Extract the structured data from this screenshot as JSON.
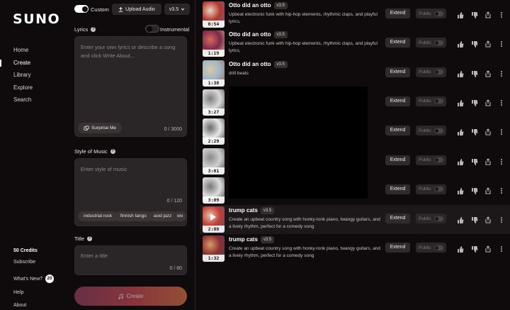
{
  "sidebar": {
    "logo": "SUNO",
    "nav": [
      "Home",
      "Create",
      "Library",
      "Explore",
      "Search"
    ],
    "active_nav": "Create",
    "credits": "50 Credits",
    "subscribe": "Subscribe",
    "whats_new": "What's New?",
    "whats_new_count": "20",
    "help": "Help",
    "about": "About"
  },
  "create_panel": {
    "custom_toggle_on": true,
    "custom_label": "Custom",
    "upload_audio": "Upload Audio",
    "version": "v3.5",
    "lyrics_label": "Lyrics",
    "instrumental_label": "Instrumental",
    "instrumental_on": false,
    "lyrics_placeholder": "Enter your own lyrics or describe a song and click Write About...",
    "lyrics_counter": "0 / 3000",
    "surprise_me": "Surprise Me",
    "style_label": "Style of Music",
    "style_placeholder": "Enter style of music",
    "style_counter": "0 / 120",
    "style_chips": [
      "industrial rock",
      "finnish tango",
      "acid jazz",
      "wo"
    ],
    "title_label": "Title",
    "title_placeholder": "Enter a title",
    "title_counter": "0 / 80",
    "create_button": "Create"
  },
  "songs": [
    {
      "title": "Otto did an otto",
      "version": "v3.5",
      "description": "Upbeat electronic funk with hip-hop elements, rhythmic claps, and playful lyrics,",
      "duration": "0:54",
      "extend": "Extend",
      "public": "Public",
      "thumb_colors": [
        "#b2352b",
        "#e8d6c2",
        "#5f6fa8"
      ]
    },
    {
      "title": "Otto did an otto",
      "version": "v3.5",
      "description": "Upbeat electronic funk with hip-hop elements, rhythmic claps, and playful lyrics,",
      "duration": "1:19",
      "extend": "Extend",
      "public": "Public",
      "thumb_colors": [
        "#7b2a4a",
        "#d6695c",
        "#e7c69a"
      ]
    },
    {
      "title": "Otto did an otto",
      "version": "v3.5",
      "description": "drill beats",
      "duration": "1:38",
      "extend": "Extend",
      "public": "Public",
      "thumb_colors": [
        "#9fb6c4",
        "#d8c9a8",
        "#a0593c"
      ]
    },
    {
      "title": "",
      "version": "",
      "description": "",
      "duration": "3:27",
      "extend": "Extend",
      "public": "Public",
      "thumb_colors": [
        "#d9d9d9",
        "#7e7e7e",
        "#2e2e2e"
      ]
    },
    {
      "title": "",
      "version": "",
      "description": "",
      "duration": "2:29",
      "extend": "Extend",
      "public": "Public",
      "thumb_colors": [
        "#e8e8e8",
        "#6a6a6a",
        "#1f1f1f"
      ]
    },
    {
      "title": "",
      "version": "",
      "description": "",
      "duration": "3:01",
      "extend": "Extend",
      "public": "Public",
      "thumb_colors": [
        "#cfcfcf",
        "#8a8a8a",
        "#3a3a3a"
      ]
    },
    {
      "title": "",
      "version": "",
      "description": "",
      "duration": "3:09",
      "extend": "Extend",
      "public": "Public",
      "thumb_colors": [
        "#dedede",
        "#777777",
        "#2a2a2a"
      ]
    },
    {
      "title": "trump cats",
      "version": "v3.5",
      "description": "Create an upbeat country song with honky-tonk piano, twangy guitars, and a lively rhythm, perfect for a comedy song",
      "duration": "2:08",
      "extend": "Extend",
      "public": "Public",
      "thumb_colors": [
        "#c23b35",
        "#e3c3a6",
        "#3d5e8a"
      ],
      "highlight": true
    },
    {
      "title": "trump cats",
      "version": "v3.5",
      "description": "Create an upbeat country song with honky-tonk piano, twangy guitars, and a lively rhythm, perfect for a comedy song",
      "duration": "1:32",
      "extend": "Extend",
      "public": "Public",
      "thumb_colors": [
        "#8b2f2f",
        "#d99a6c",
        "#2f4870"
      ]
    }
  ]
}
